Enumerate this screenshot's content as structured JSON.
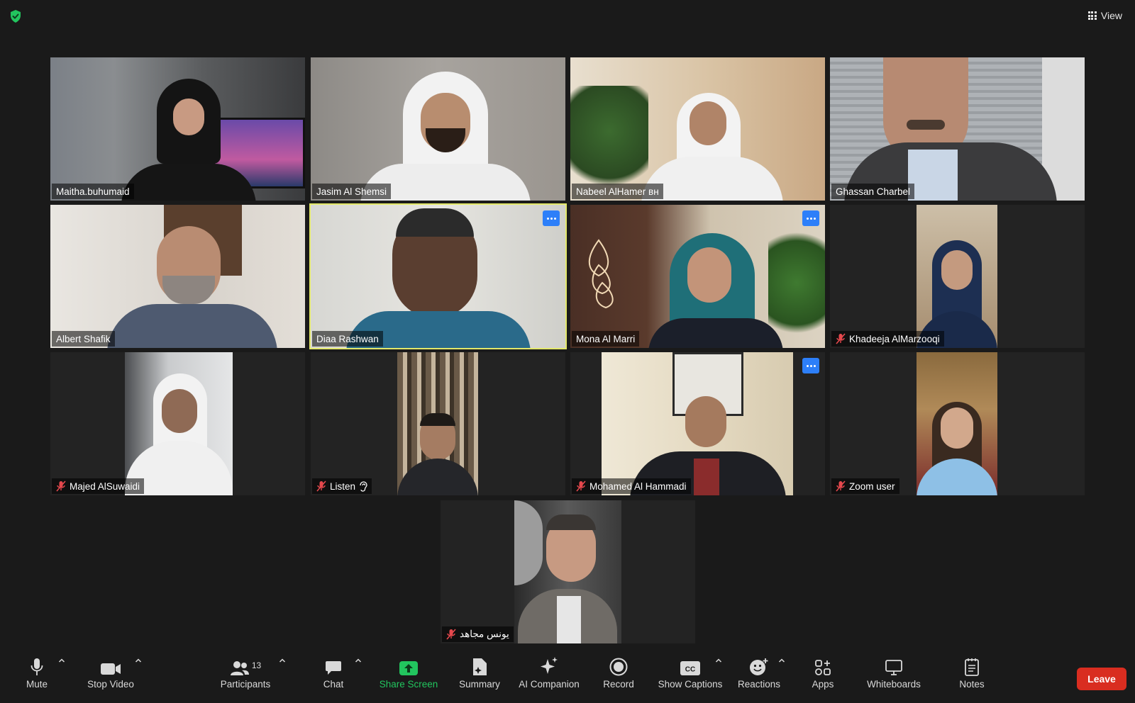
{
  "top_bar": {
    "view_label": "View"
  },
  "participants": [
    {
      "name": "Maitha.buhumaid",
      "muted": false
    },
    {
      "name": "Jasim Al Shemsi",
      "muted": false
    },
    {
      "name": "Nabeel AlHamer ʙʜ",
      "muted": false
    },
    {
      "name": "Ghassan Charbel",
      "muted": false
    },
    {
      "name": "Albert Shafik",
      "muted": false
    },
    {
      "name": "Diaa Rashwan",
      "muted": false,
      "active_speaker": true
    },
    {
      "name": "Mona Al Marri",
      "muted": false
    },
    {
      "name": "Khadeeja AlMarzooqi",
      "muted": true
    },
    {
      "name": "Majed AlSuwaidi",
      "muted": true
    },
    {
      "name": "Listen",
      "muted": true,
      "icon": "ear-icon"
    },
    {
      "name": "Mohamed Al Hammadi",
      "muted": true
    },
    {
      "name": "Zoom user",
      "muted": true
    },
    {
      "name": "يونس مجاهد",
      "muted": true
    }
  ],
  "toolbar": {
    "mute_label": "Mute",
    "stop_video_label": "Stop Video",
    "participants_label": "Participants",
    "participants_count": "13",
    "chat_label": "Chat",
    "share_screen_label": "Share Screen",
    "summary_label": "Summary",
    "ai_companion_label": "AI Companion",
    "record_label": "Record",
    "show_captions_label": "Show Captions",
    "cc_text": "CC",
    "reactions_label": "Reactions",
    "apps_label": "Apps",
    "whiteboards_label": "Whiteboards",
    "notes_label": "Notes",
    "leave_label": "Leave"
  },
  "colors": {
    "background": "#1a1a1a",
    "tile": "#232323",
    "active_border": "#e3e86a",
    "share_green": "#22c55e",
    "leave_red": "#d92d20",
    "more_blue": "#2d7ff9",
    "muted_red": "#e5484d"
  }
}
